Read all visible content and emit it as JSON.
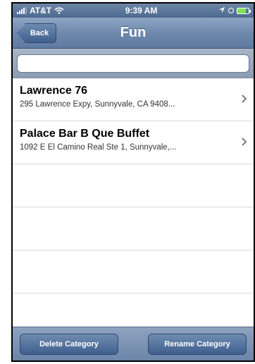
{
  "status_bar": {
    "carrier": "AT&T",
    "time": "9:39 AM",
    "icons": [
      "signal-icon",
      "wifi-icon",
      "location-icon",
      "lock-icon",
      "battery-icon"
    ]
  },
  "nav": {
    "back_label": "Back",
    "title": "Fun"
  },
  "search": {
    "value": "",
    "placeholder": ""
  },
  "list": {
    "items": [
      {
        "title": "Lawrence 76",
        "subtitle": "295 Lawrence Expy, Sunnyvale, CA 9408..."
      },
      {
        "title": "Palace Bar B Que Buffet",
        "subtitle": "1092 E El Camino Real Ste 1, Sunnyvale,..."
      }
    ]
  },
  "toolbar": {
    "delete_label": "Delete Category",
    "rename_label": "Rename Category"
  },
  "colors": {
    "nav_blue": "#6f89ad",
    "button_blue": "#3f5f8d",
    "battery_green": "#7fe35b"
  }
}
